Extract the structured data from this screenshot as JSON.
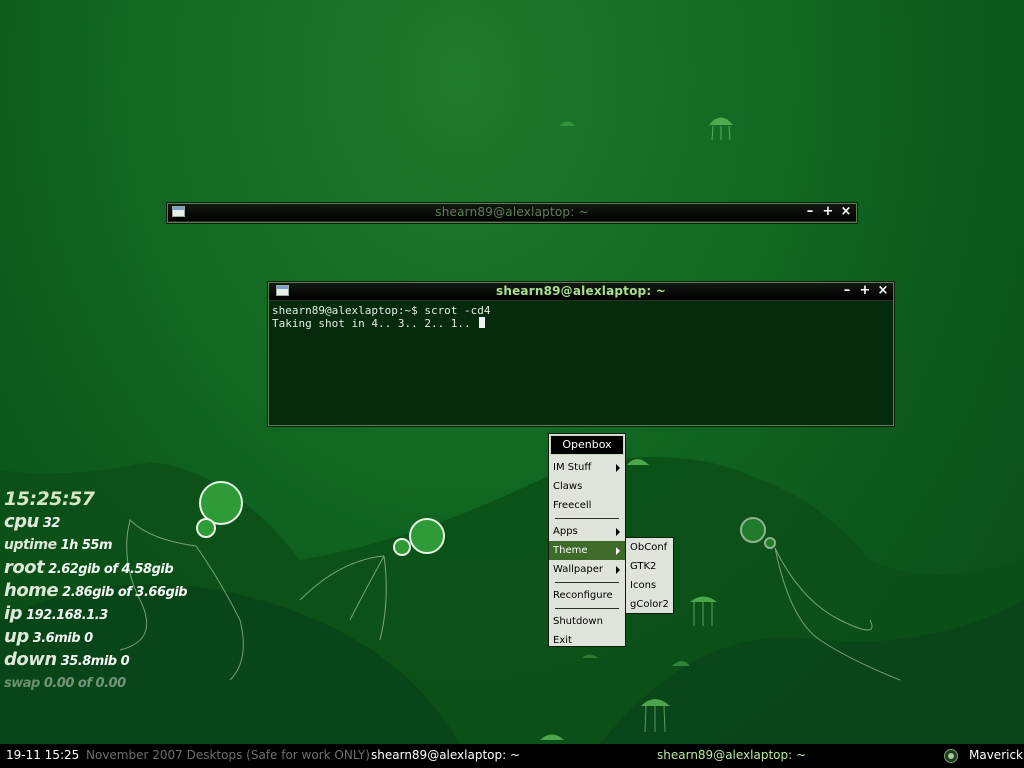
{
  "windows": {
    "minimized_terminal": {
      "title": "shearn89@alexlaptop: ~"
    },
    "terminal": {
      "title": "shearn89@alexlaptop: ~",
      "lines": [
        "shearn89@alexlaptop:~$ scrot -cd4",
        "Taking shot in 4.. 3.. 2.. 1.. "
      ]
    },
    "buttons": {
      "minimize": "–",
      "maximize": "+",
      "close": "×"
    }
  },
  "menu": {
    "title": "Openbox",
    "items": [
      "IM Stuff",
      "Claws",
      "Freecell",
      "Apps",
      "Theme",
      "Wallpaper",
      "Reconfigure",
      "Shutdown",
      "Exit"
    ],
    "theme_submenu": [
      "ObConf",
      "GTK2",
      "Icons",
      "gColor2"
    ]
  },
  "conky": {
    "clock": "15:25:57",
    "rows": [
      {
        "key": "cpu",
        "value": "32"
      },
      {
        "key": "uptime",
        "value": "1h 55m"
      },
      {
        "key": "root",
        "value": "2.62gib of 4.58gib"
      },
      {
        "key": "home",
        "value": "2.86gib of 3.66gib"
      },
      {
        "key": "ip",
        "value": "192.168.1.3"
      },
      {
        "key": "up",
        "value": "3.6mib 0"
      },
      {
        "key": "down",
        "value": "35.8mib 0"
      },
      {
        "key": "swap",
        "value": "0.00 of 0.00"
      }
    ]
  },
  "taskbar": {
    "clock": "19-11 15:25",
    "desktop_name": "November 2007 Desktops (Safe for work ONLY)",
    "task_left": "shearn89@alexlaptop: ~",
    "task_center": "shearn89@alexlaptop: ~",
    "tray_label": "Maverick"
  },
  "colors": {
    "accent_green": "#a9e08f",
    "menu_highlight": "#3f6b2a",
    "terminal_bg": "#052a0c"
  }
}
